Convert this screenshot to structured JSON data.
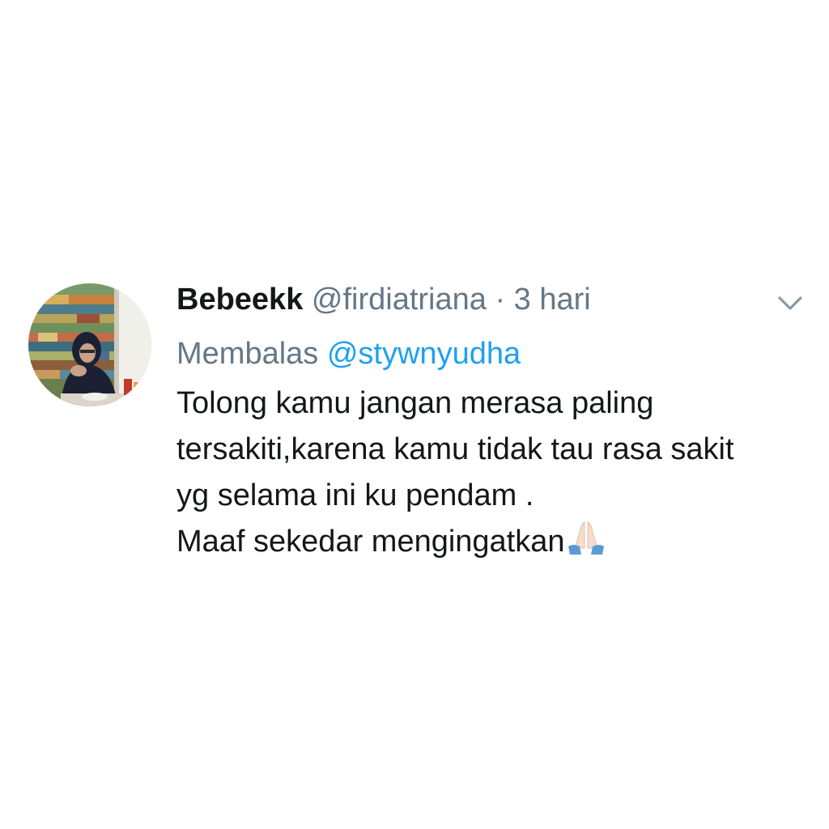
{
  "tweet": {
    "display_name": "Bebeekk",
    "handle": "@firdiatriana",
    "separator": "·",
    "time": "3 hari",
    "reply_prefix": "Membalas",
    "reply_to": "@stywnyudha",
    "text_lines": [
      "Tolong kamu jangan merasa paling",
      "tersakiti,karena kamu tidak tau rasa sakit",
      "yg selama ini ku pendam .",
      "Maaf sekedar mengingatkan"
    ],
    "text_emoji": "folded-hands-icon"
  },
  "icons": {
    "more": "chevron-down-icon",
    "avatar": "profile-photo"
  },
  "colors": {
    "text": "#14171a",
    "muted": "#657786",
    "link": "#1da1f2",
    "background": "#ffffff"
  }
}
